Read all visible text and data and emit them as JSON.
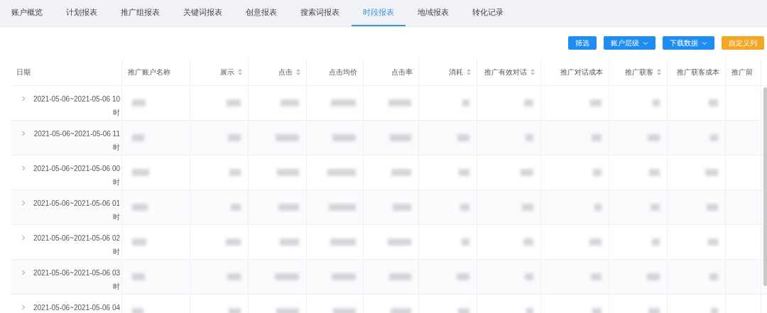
{
  "tabs": [
    {
      "label": "账户概览",
      "selected": false
    },
    {
      "label": "计划报表",
      "selected": false
    },
    {
      "label": "推广组报表",
      "selected": false
    },
    {
      "label": "关键词报表",
      "selected": false
    },
    {
      "label": "创意报表",
      "selected": false
    },
    {
      "label": "搜索词报表",
      "selected": false
    },
    {
      "label": "时段报表",
      "selected": true
    },
    {
      "label": "地域报表",
      "selected": false
    },
    {
      "label": "转化记录",
      "selected": false
    }
  ],
  "toolbar": [
    {
      "label": "筛选",
      "kind": "primary",
      "dropdown": false
    },
    {
      "label": "账户层级",
      "kind": "primary",
      "dropdown": true
    },
    {
      "label": "下载数据",
      "kind": "primary",
      "dropdown": true
    },
    {
      "label": "自定义列",
      "kind": "warning",
      "dropdown": false
    }
  ],
  "table": {
    "columns": [
      {
        "label": "日期",
        "sortable": false
      },
      {
        "label": "推广账户名称",
        "sortable": false
      },
      {
        "label": "展示",
        "sortable": true
      },
      {
        "label": "点击",
        "sortable": true
      },
      {
        "label": "点击均价",
        "sortable": false
      },
      {
        "label": "点击率",
        "sortable": false
      },
      {
        "label": "消耗",
        "sortable": true
      },
      {
        "label": "推广有效对话",
        "sortable": true
      },
      {
        "label": "推广对话成本",
        "sortable": false
      },
      {
        "label": "推广获客",
        "sortable": true
      },
      {
        "label": "推广获客成本",
        "sortable": false
      },
      {
        "label": "推广留"
      }
    ],
    "rows": [
      {
        "date": "2021-05-06~2021-05-06 10 时",
        "expanded": false
      },
      {
        "date": "2021-05-06~2021-05-06 11 时",
        "expanded": false
      },
      {
        "date": "2021-05-06~2021-05-06 00 时",
        "expanded": false
      },
      {
        "date": "2021-05-06~2021-05-06 01 时",
        "expanded": false
      },
      {
        "date": "2021-05-06~2021-05-06 02 时",
        "expanded": false
      },
      {
        "date": "2021-05-06~2021-05-06 03 时",
        "expanded": false
      },
      {
        "date": "2021-05-06~2021-05-06 04",
        "expanded": false
      }
    ]
  }
}
